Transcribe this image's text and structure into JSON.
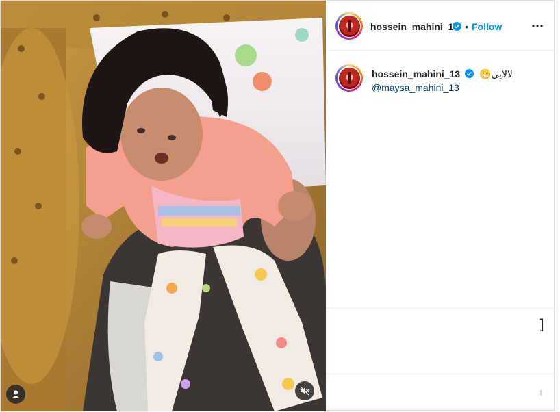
{
  "post": {
    "username": "hossein_mahini_13",
    "dot": "•",
    "follow_label": "Follow",
    "caption": "لالایی😁",
    "mention": "@maysa_mahini_13",
    "input_fragment": "]",
    "post_fragment": "t"
  },
  "icons": {
    "verified": "verified-badge-icon",
    "more": "more-options-icon",
    "tags": "user-tags-icon",
    "mute": "muted-speaker-icon"
  },
  "colors": {
    "accent": "#0095f6",
    "mention": "#00376b",
    "sofa": "#b58a3a",
    "shirt": "#f4a08e"
  }
}
